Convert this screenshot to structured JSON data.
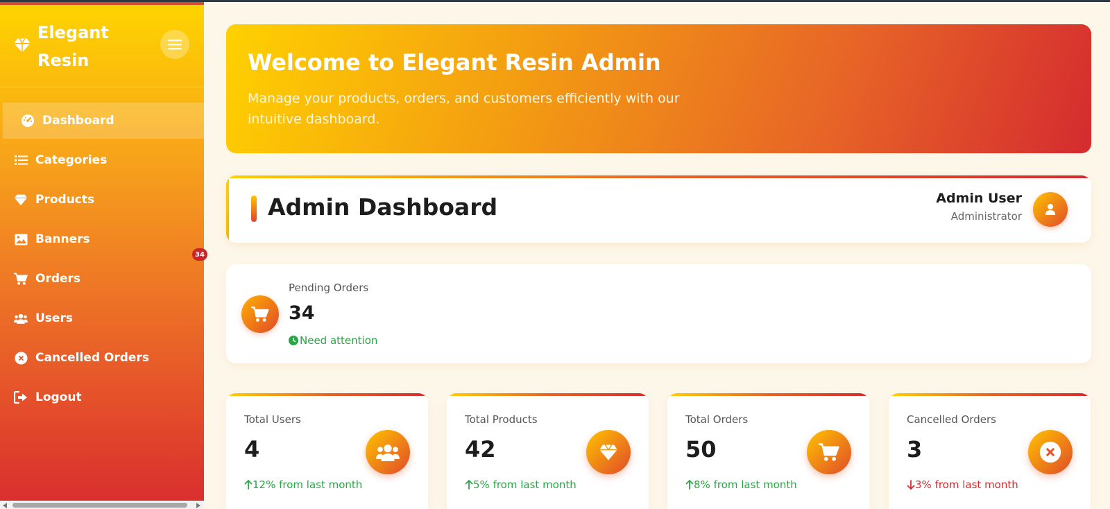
{
  "colors": {
    "accent_yellow": "#ffd100",
    "accent_orange": "#e76427",
    "accent_red": "#d42b2f",
    "success": "#28a745",
    "danger": "#d42b2f"
  },
  "sidebar": {
    "brand": "Elegant Resin",
    "brand_icon": "diamond-icon",
    "toggle_icon": "hamburger-icon",
    "items": [
      {
        "label": "Dashboard",
        "icon": "gauge-icon",
        "active": true
      },
      {
        "label": "Categories",
        "icon": "list-icon"
      },
      {
        "label": "Products",
        "icon": "diamond-icon"
      },
      {
        "label": "Banners",
        "icon": "image-icon"
      },
      {
        "label": "Orders",
        "icon": "cart-icon",
        "badge": "34"
      },
      {
        "label": "Users",
        "icon": "users-icon"
      },
      {
        "label": "Cancelled Orders",
        "icon": "x-circle-icon"
      },
      {
        "label": "Logout",
        "icon": "logout-icon"
      }
    ]
  },
  "hero": {
    "title": "Welcome to Elegant Resin Admin",
    "subtitle": "Manage your products, orders, and customers efficiently with our intuitive dashboard."
  },
  "header": {
    "title": "Admin Dashboard",
    "user_name": "Admin User",
    "user_role": "Administrator",
    "avatar_icon": "user-icon"
  },
  "pending": {
    "label": "Pending Orders",
    "value": "34",
    "note": "Need attention",
    "icon": "cart-icon"
  },
  "stats": [
    {
      "label": "Total Users",
      "value": "4",
      "trend": "12% from last month",
      "direction": "up",
      "icon": "users-icon"
    },
    {
      "label": "Total Products",
      "value": "42",
      "trend": "5% from last month",
      "direction": "up",
      "icon": "diamond-icon"
    },
    {
      "label": "Total Orders",
      "value": "50",
      "trend": "8% from last month",
      "direction": "up",
      "icon": "cart-icon"
    },
    {
      "label": "Cancelled Orders",
      "value": "3",
      "trend": "3% from last month",
      "direction": "down",
      "icon": "x-circle-icon"
    }
  ]
}
